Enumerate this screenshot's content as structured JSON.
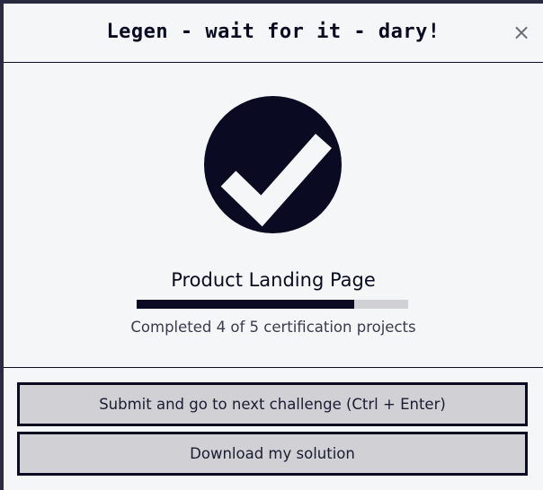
{
  "modal": {
    "title": "Legen - wait for it - dary!",
    "close_glyph": "×"
  },
  "body": {
    "check_icon": "check-circle-icon",
    "challenge_name": "Product Landing Page",
    "progress": {
      "completed": 4,
      "total": 5,
      "percent": 80,
      "text": "Completed 4 of 5 certification projects"
    }
  },
  "footer": {
    "submit_label": "Submit and go to next challenge (Ctrl + Enter)",
    "download_label": "Download my solution"
  },
  "colors": {
    "primary": "#0a0a23",
    "background": "#f5f6f7",
    "button_bg": "#d0d0d5",
    "progress_track": "#d0d0d5"
  }
}
